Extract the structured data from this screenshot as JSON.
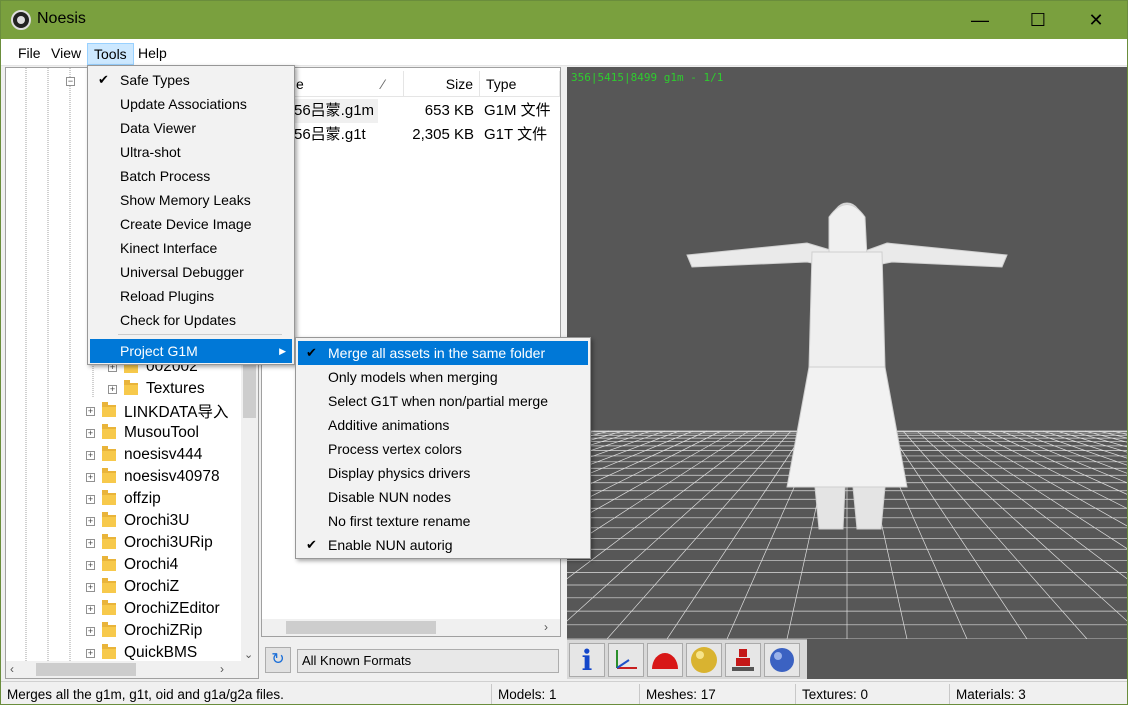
{
  "window": {
    "title": "Noesis",
    "minimize_label": "—",
    "maximize_label": "☐",
    "close_label": "✕"
  },
  "menubar": {
    "file": "File",
    "view": "View",
    "tools": "Tools",
    "help": "Help"
  },
  "tree": {
    "items": [
      {
        "label": "002002",
        "expander": "+"
      },
      {
        "label": "Textures",
        "expander": "+"
      },
      {
        "label": "LINKDATA导入",
        "expander": "+"
      },
      {
        "label": "MusouTool",
        "expander": "+"
      },
      {
        "label": "noesisv444",
        "expander": "+"
      },
      {
        "label": "noesisv40978",
        "expander": "+"
      },
      {
        "label": "offzip",
        "expander": "+"
      },
      {
        "label": "Orochi3U",
        "expander": "+"
      },
      {
        "label": "Orochi3URip",
        "expander": "+"
      },
      {
        "label": "Orochi4",
        "expander": "+"
      },
      {
        "label": "OrochiZ",
        "expander": "+"
      },
      {
        "label": "OrochiZEditor",
        "expander": "+"
      },
      {
        "label": "OrochiZRip",
        "expander": "+"
      },
      {
        "label": "QuickBMS",
        "expander": "+"
      }
    ],
    "top_expander": "−"
  },
  "filelist": {
    "columns": {
      "name": "e",
      "sort_indicator": "⁄",
      "size": "Size",
      "type": "Type"
    },
    "rows": [
      {
        "name": "56吕蒙.g1m",
        "size": "653 KB",
        "type": "G1M 文件"
      },
      {
        "name": "56吕蒙.g1t",
        "size": "2,305 KB",
        "type": "G1T 文件"
      }
    ],
    "refresh_icon": "↻",
    "format_filter": "All Known Formats"
  },
  "viewport": {
    "info": "356|5415|8499 g1m - 1/1"
  },
  "toolbar3d": {
    "buttons": [
      "info-icon",
      "axes-icon",
      "red-dome-icon",
      "gold-sphere-icon",
      "red-robot-icon",
      "blue-sphere-icon"
    ],
    "info_glyph": "i"
  },
  "tools_menu": {
    "items": [
      {
        "label": "Safe Types",
        "checked": true
      },
      {
        "label": "Update Associations"
      },
      {
        "label": "Data Viewer"
      },
      {
        "label": "Ultra-shot"
      },
      {
        "label": "Batch Process"
      },
      {
        "label": "Show Memory Leaks"
      },
      {
        "label": "Create Device Image"
      },
      {
        "label": "Kinect Interface"
      },
      {
        "label": "Universal Debugger"
      },
      {
        "label": "Reload Plugins"
      },
      {
        "label": "Check for Updates"
      }
    ],
    "submenu_item": {
      "label": "Project G1M",
      "arrow": "▶"
    },
    "check_glyph": "✔"
  },
  "g1m_menu": {
    "items": [
      {
        "label": "Merge all assets in the same folder",
        "checked": true,
        "highlighted": true
      },
      {
        "label": "Only models when merging"
      },
      {
        "label": "Select G1T when non/partial merge"
      },
      {
        "label": "Additive animations"
      },
      {
        "label": "Process vertex colors"
      },
      {
        "label": "Display physics drivers"
      },
      {
        "label": "Disable NUN nodes"
      },
      {
        "label": "No first texture rename"
      },
      {
        "label": "Enable NUN autorig",
        "checked": true
      }
    ]
  },
  "statusbar": {
    "message": "Merges all the g1m, g1t, oid and g1a/g2a files.",
    "models": "Models: 1",
    "meshes": "Meshes: 17",
    "textures": "Textures: 0",
    "materials": "Materials: 3"
  },
  "colors": {
    "titlebar": "#7aa03e",
    "highlight": "#0078d7",
    "viewport_bg": "#575757",
    "info_text": "#2ecc2e"
  }
}
